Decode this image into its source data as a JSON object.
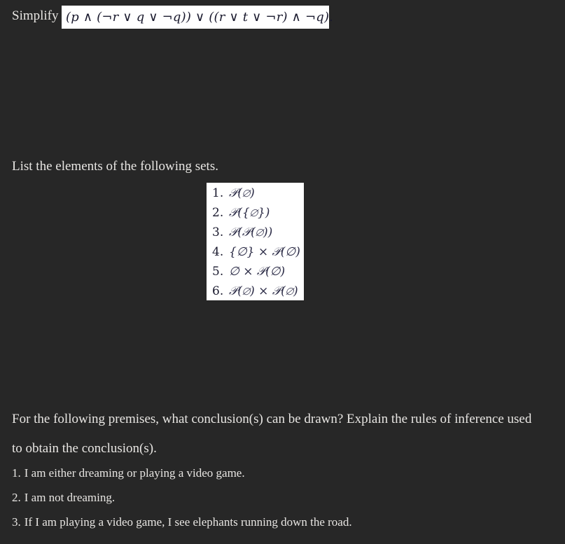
{
  "page": {
    "background_color": "#272727",
    "text_color": "#e8e6e3",
    "box_background_color": "#ffffff",
    "box_text_color": "#1a1a2e"
  },
  "simplify": {
    "label": "Simplify",
    "formula": "(p ∧ (¬r ∨ q ∨ ¬q)) ∨ ((r ∨ t ∨ ¬r) ∧ ¬q)."
  },
  "sets": {
    "prompt": "List the elements of the following sets.",
    "items": [
      {
        "number": "1.",
        "expression": "𝒫(∅)"
      },
      {
        "number": "2.",
        "expression": "𝒫({∅})"
      },
      {
        "number": "3.",
        "expression": "𝒫(𝒫(∅))"
      },
      {
        "number": "4.",
        "expression": "{∅} × 𝒫(∅)"
      },
      {
        "number": "5.",
        "expression": "∅ × 𝒫(∅)"
      },
      {
        "number": "6.",
        "expression": "𝒫(∅) × 𝒫(∅)"
      }
    ]
  },
  "inference": {
    "question_line1": "For the following premises, what conclusion(s) can be drawn? Explain the rules of inference used",
    "question_line2": "to obtain the conclusion(s).",
    "premises": [
      {
        "number": "1.",
        "text": "I am either dreaming or playing a video game."
      },
      {
        "number": "2.",
        "text": "I am not dreaming."
      },
      {
        "number": "3.",
        "text": "If I am playing a video game, I see elephants running down the road."
      }
    ]
  }
}
